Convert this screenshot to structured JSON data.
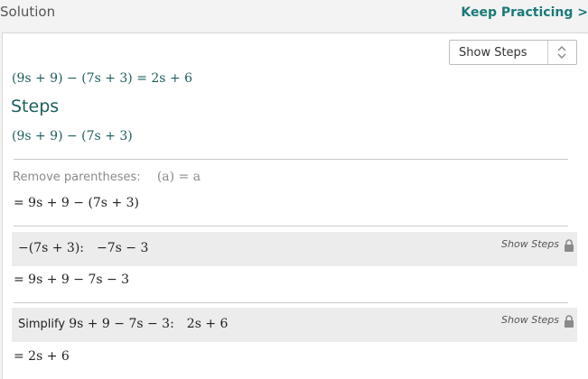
{
  "header": {
    "title": "Solution",
    "keep_practicing": "Keep Practicing >"
  },
  "select": {
    "value": "Show Steps"
  },
  "main_equation": {
    "lhs_a": "(9s + 9)",
    "minus": " − ",
    "lhs_b": "(7s + 3)",
    "eq": " = 2s + 6"
  },
  "steps": {
    "title": "Steps",
    "expression": "(9s + 9) − (7s + 3)",
    "rule_label": "Remove parentheses:",
    "rule_formula": "(a) = a",
    "result1": "= 9s + 9 − (7s + 3)",
    "box1": {
      "expr": "−(7s + 3):",
      "result": "−7s − 3",
      "show_steps": "Show Steps"
    },
    "result2": "= 9s + 9 − 7s − 3",
    "box2": {
      "label": "Simplify ",
      "expr": "9s + 9 − 7s − 3:",
      "result": "2s + 6",
      "show_steps": "Show Steps"
    },
    "result3": "= 2s + 6"
  },
  "icons": {
    "lock": "lock-icon",
    "select_arrows": "up-down-arrows-icon"
  },
  "colors": {
    "accent": "#1a7a78",
    "math_teal": "#1b5e5c",
    "box_bg": "#ececec"
  }
}
